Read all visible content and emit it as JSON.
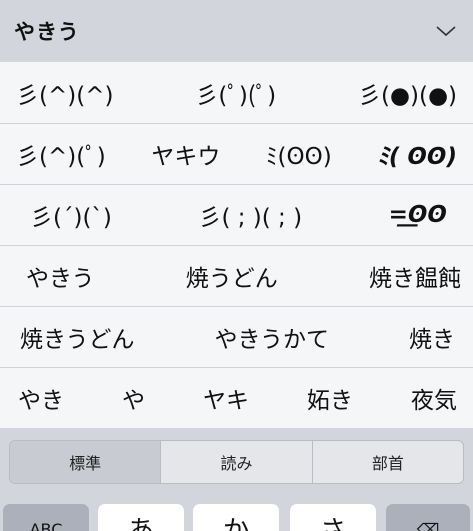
{
  "header": {
    "query": "やきう"
  },
  "candidates": [
    [
      "彡(^)(^)",
      "彡(ﾟ)(ﾟ)",
      "彡(●)(●)"
    ],
    [
      "彡(^)(ﾟ)",
      "ヤキウ",
      "ﾐ(ʘʘ)",
      "ﾐ( ʘʘ)"
    ],
    [
      "彡(ˊ)(ˋ)",
      "彡( ; )( ; )",
      "=͟͟ʘʘ"
    ],
    [
      "やきう",
      "焼うどん",
      "焼き饂飩"
    ],
    [
      "焼きうどん",
      "やきうかて",
      "焼き"
    ],
    [
      "やき",
      "や",
      "ヤキ",
      "妬き",
      "夜気"
    ]
  ],
  "tabs": [
    "標準",
    "読み",
    "部首"
  ],
  "keys": [
    "ABC",
    "あ",
    "か",
    "さ",
    "⌫"
  ]
}
